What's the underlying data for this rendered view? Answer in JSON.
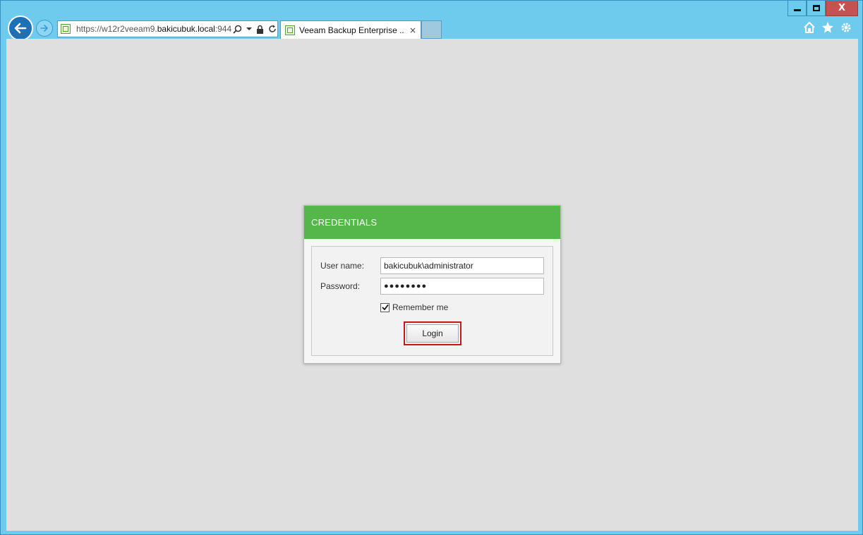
{
  "browser": {
    "url_prefix": "https://w12r2veeam9.",
    "url_domain": "bakicubuk.local",
    "url_suffix": ":944",
    "tab_title": "Veeam Backup Enterprise ...",
    "tab_close": "×",
    "caption": {
      "close": "X"
    },
    "icons": {
      "back": "back-arrow-icon",
      "forward": "forward-arrow-icon",
      "search": "search-icon",
      "dropdown": "chevron-down-icon",
      "lock": "lock-icon",
      "refresh": "refresh-icon",
      "home": "home-icon",
      "favorites": "star-icon",
      "settings": "gear-icon"
    }
  },
  "dialog": {
    "title": "CREDENTIALS",
    "header_color": "#55b74a",
    "username_label": "User name:",
    "username_value": "bakicubuk\\administrator",
    "password_label": "Password:",
    "password_value": "●●●●●●●●",
    "remember_label": "Remember me",
    "remember_checked": true,
    "login_label": "Login",
    "highlight_color": "#c4161c"
  }
}
